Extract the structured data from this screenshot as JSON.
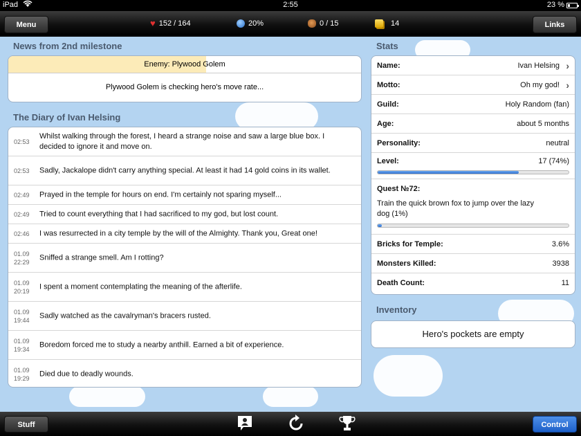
{
  "status_bar": {
    "carrier": "iPad",
    "time": "2:55",
    "battery": "23 %"
  },
  "top_bar": {
    "menu_label": "Menu",
    "links_label": "Links",
    "health": "152 / 164",
    "godpower": "20%",
    "inventory": "0 / 15",
    "gold": "14"
  },
  "news": {
    "title": "News from 2nd milestone",
    "enemy": "Enemy: Plywood Golem",
    "enemy_health_fraction": 0.56,
    "message": "Plywood Golem is checking hero's move rate..."
  },
  "diary": {
    "title": "The Diary of Ivan Helsing",
    "entries": [
      {
        "time": "02:53",
        "text": "Whilst walking through the forest, I heard a strange noise and saw a large blue box. I decided to ignore it and move on."
      },
      {
        "time": "02:53",
        "text": "Sadly, Jackalope didn't carry anything special. At least it had 14 gold coins in its wallet."
      },
      {
        "time": "02:49",
        "text": "Prayed in the temple for hours on end. I'm certainly not sparing myself..."
      },
      {
        "time": "02:49",
        "text": "Tried to count everything that I had sacrificed to my god, but lost count."
      },
      {
        "time": "02:46",
        "text": "I was resurrected in a city temple by the will of the Almighty. Thank you, Great one!"
      },
      {
        "date": "01.09",
        "time": "22:29",
        "text": "Sniffed a strange smell. Am I rotting?"
      },
      {
        "date": "01.09",
        "time": "20:19",
        "text": "I spent a moment contemplating the meaning of the afterlife."
      },
      {
        "date": "01.09",
        "time": "19:44",
        "text": "Sadly watched as the cavalryman's bracers rusted."
      },
      {
        "date": "01.09",
        "time": "19:34",
        "text": "Boredom forced me to study a nearby anthill. Earned a bit of experience."
      },
      {
        "date": "01.09",
        "time": "19:29",
        "text": "Died due to deadly wounds."
      }
    ]
  },
  "stats": {
    "title": "Stats",
    "name_label": "Name:",
    "name": "Ivan Helsing",
    "motto_label": "Motto:",
    "motto": "Oh my god!",
    "guild_label": "Guild:",
    "guild": "Holy Random (fan)",
    "age_label": "Age:",
    "age": "about 5 months",
    "personality_label": "Personality:",
    "personality": "neutral",
    "level_label": "Level:",
    "level": "17 (74%)",
    "level_progress": 0.74,
    "quest_label": "Quest №72:",
    "quest_text": "Train the quick brown fox to jump over the lazy dog (1%)",
    "quest_progress": 0.01,
    "bricks_label": "Bricks for Temple:",
    "bricks": "3.6%",
    "monsters_label": "Monsters Killed:",
    "monsters": "3938",
    "deaths_label": "Death Count:",
    "deaths": "11"
  },
  "inventory": {
    "title": "Inventory",
    "empty_text": "Hero's pockets are empty"
  },
  "bottom_bar": {
    "stuff_label": "Stuff",
    "control_label": "Control"
  },
  "icons": [
    "wifi-icon",
    "battery-icon",
    "heart-icon",
    "godpower-icon",
    "bag-icon",
    "coins-icon",
    "chevron-right-icon",
    "chat-icon",
    "refresh-icon",
    "trophy-icon"
  ]
}
